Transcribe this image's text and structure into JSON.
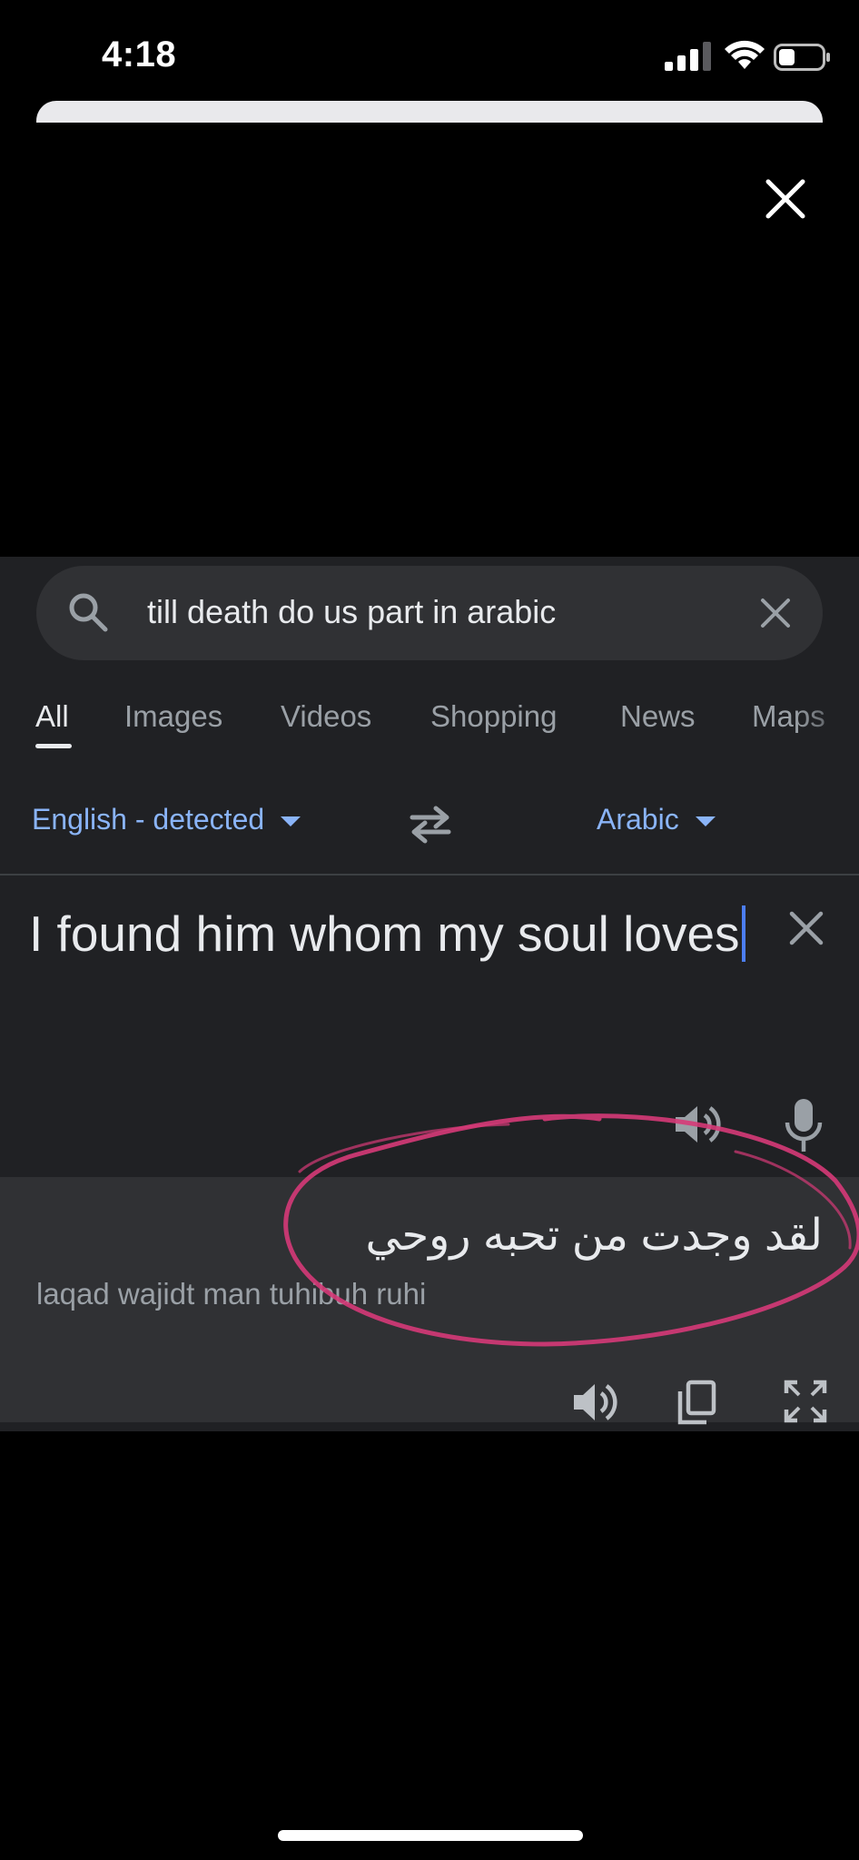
{
  "status_bar": {
    "time": "4:18",
    "signal_icon": "cellular-signal-icon",
    "wifi_icon": "wifi-icon",
    "battery_icon": "battery-icon"
  },
  "overlay": {
    "close_icon": "close-icon"
  },
  "search": {
    "query": "till death do us part in arabic",
    "search_icon": "search-icon",
    "clear_icon": "close-icon"
  },
  "tabs": [
    {
      "label": "All",
      "active": true
    },
    {
      "label": "Images",
      "active": false
    },
    {
      "label": "Videos",
      "active": false
    },
    {
      "label": "Shopping",
      "active": false
    },
    {
      "label": "News",
      "active": false
    },
    {
      "label": "Maps",
      "active": false
    }
  ],
  "translate": {
    "source_language": "English - detected",
    "target_language": "Arabic",
    "swap_icon": "swap-arrows-icon",
    "source_text": "I found him whom my soul loves",
    "translated_text": "لقد وجدت من تحبه روحي",
    "transliteration": "laqad wajidt man tuhibuh ruhi"
  },
  "colors": {
    "background": "#000000",
    "panel": "#202124",
    "surface": "#303134",
    "link_blue": "#8ab4f8",
    "cursor_blue": "#4c7ef3",
    "annotation_pink": "#d63a78"
  }
}
